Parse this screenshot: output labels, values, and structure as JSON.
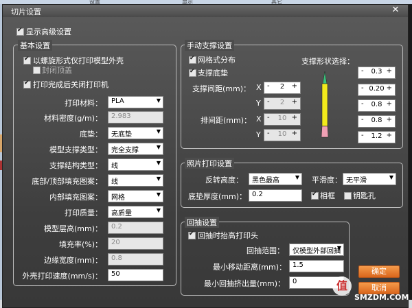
{
  "background": {
    "tabs": [
      "设置",
      "显示",
      "其它"
    ]
  },
  "window": {
    "title": "切片设置",
    "close_glyph": "✕"
  },
  "show_advanced": {
    "label": "显示高级设置",
    "checked": true
  },
  "basic": {
    "title": "基本设置",
    "spiral_outer": {
      "label": "以螺旋形式仅打印模型外壳",
      "checked": true
    },
    "close_top": {
      "label": "封闭顶盖",
      "checked": false
    },
    "shutdown": {
      "label": "打印完成后关闭打印机",
      "checked": true
    },
    "rows": {
      "material": {
        "label": "打印材料：",
        "value": "PLA"
      },
      "density": {
        "label": "材料密度(g/m)：",
        "value": "2.983"
      },
      "base": {
        "label": "底垫：",
        "value": "无底垫"
      },
      "support_type": {
        "label": "模型支撑类型：",
        "value": "完全支撑"
      },
      "support_struct": {
        "label": "支撑结构类型：",
        "value": "线"
      },
      "fill_pattern": {
        "label": "底部/顶部填充图案：",
        "value": "线"
      },
      "inner_pattern": {
        "label": "内部填充图案：",
        "value": "网格"
      },
      "quality": {
        "label": "打印质量：",
        "value": "高质量"
      },
      "layer_height": {
        "label": "模型层高(mm)：",
        "value": "0.2"
      },
      "fill_rate": {
        "label": "填充率(%)：",
        "value": "20"
      },
      "edge_width": {
        "label": "边缘宽度(mm)：",
        "value": "0.8"
      },
      "shell_speed": {
        "label": "外壳打印速度(mm/s)：",
        "value": "50"
      }
    }
  },
  "manual": {
    "title": "手动支撑设置",
    "grid": {
      "label": "网格式分布",
      "checked": true
    },
    "base": {
      "label": "支撑底垫",
      "checked": true
    },
    "shape_label": "支撑形状选择：",
    "spacing_label": "支撑间距(mm)：",
    "row_spacing_label": "排间距(mm)：",
    "x": "X",
    "y": "Y",
    "spacing_x": "2",
    "spacing_y": "2",
    "row_x": "10",
    "row_y": "10",
    "shape_values": [
      "0.3",
      "0.20",
      "0.8",
      "0.8",
      "1.2"
    ],
    "minus": "-",
    "plus": "+",
    "colors": {
      "top": "#3ac07a",
      "mid": "#f2ea1c",
      "bottom": "#f0a0b4"
    }
  },
  "photo": {
    "title": "照片打印设置",
    "invert_label": "反转高度：",
    "invert_value": "黑色最高",
    "smooth_label": "平滑度：",
    "smooth_value": "无平滑",
    "base_thick_label": "底垫厚度(mm)：",
    "base_thick_value": "0.2",
    "frame": {
      "label": "相框",
      "checked": true
    },
    "keyhole": {
      "label": "钥匙孔",
      "checked": false
    }
  },
  "retract": {
    "title": "回抽设置",
    "lift": {
      "label": "回抽时抬高打印头",
      "checked": true
    },
    "range_label": "回抽范围：",
    "range_value": "仅模型外部回抽",
    "min_move_label": "最小移动距离(mm)：",
    "min_move_value": "1.5",
    "min_extrude_label": "最小回抽挤出量(mm)：",
    "min_extrude_value": "0"
  },
  "buttons": {
    "ok": "确定",
    "cancel": "取消"
  },
  "watermark": {
    "glyph": "值",
    "text": "SMZDM.COM"
  }
}
